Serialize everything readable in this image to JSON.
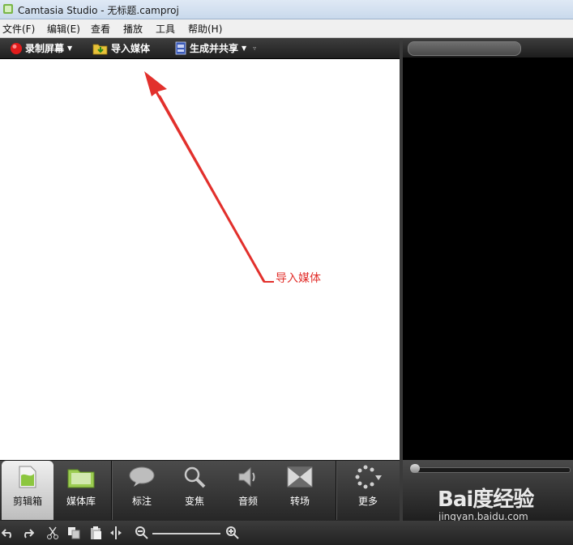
{
  "window": {
    "title": "Camtasia Studio - 无标题.camproj"
  },
  "menu": [
    "文件(F)",
    "编辑(E)",
    "查看",
    "播放",
    "工具",
    "帮助(H)"
  ],
  "toolbar": {
    "record": "录制屏幕",
    "import": "导入媒体",
    "produce": "生成并共享"
  },
  "tasks": [
    "剪辑箱",
    "媒体库",
    "标注",
    "变焦",
    "音频",
    "转场",
    "更多"
  ],
  "annotation": {
    "text": "导入媒体",
    "color": "#e2302c"
  },
  "watermark": {
    "logo": "Bai度经验",
    "url": "jingyan.baidu.com"
  }
}
